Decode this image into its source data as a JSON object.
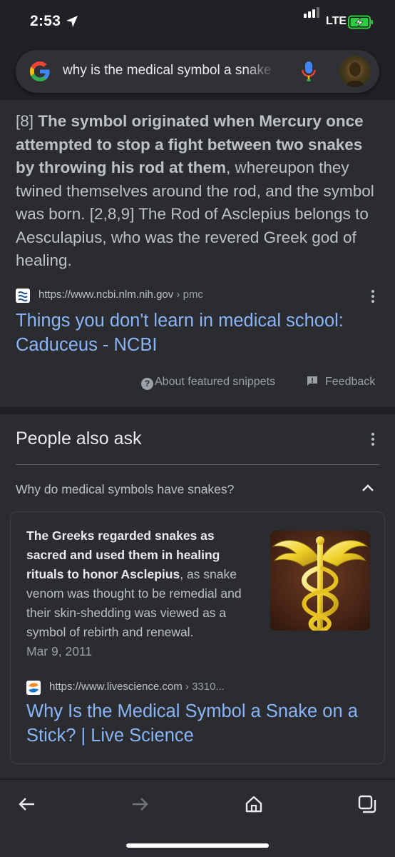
{
  "status_bar": {
    "time": "2:53",
    "network": "LTE"
  },
  "search": {
    "query": "why is the medical symbol a snake"
  },
  "featured_snippet": {
    "text_part1": "[8] ",
    "text_bold": "The symbol originated when Mercury once attempted to stop a fight between two snakes by throwing his rod at them",
    "text_part2": ", whereupon they twined themselves around the rod, and the symbol was born. [2,8,9] The Rod of Asclepius belongs to Aesculapius, who was the revered Greek god of healing.",
    "source_url": "https://www.ncbi.nlm.nih.gov",
    "source_path": " › pmc",
    "link_title": "Things you don't learn in medical school: Caduceus - NCBI",
    "about_label": "About featured snippets",
    "feedback_label": "Feedback"
  },
  "people_also_ask": {
    "title": "People also ask",
    "question": "Why do medical symbols have snakes?",
    "answer_bold": "The Greeks regarded snakes as sacred and used them in healing rituals to honor Asclepius",
    "answer_rest": ", as snake venom was thought to be remedial and their skin-shedding was viewed as a symbol of rebirth and renewal.",
    "answer_date": "Mar 9, 2011",
    "source_url": "https://www.livescience.com",
    "source_path": " › 3310...",
    "link_title": "Why Is the Medical Symbol a Snake on a Stick? | Live Science"
  },
  "colors": {
    "background": "#202124",
    "card": "#2b2c2f",
    "link": "#8ab4f8",
    "text": "#bdc1c6"
  }
}
